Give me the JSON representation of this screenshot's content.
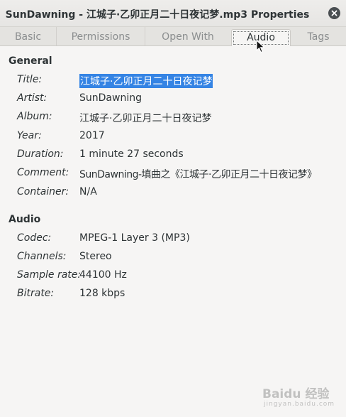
{
  "window": {
    "title": "SunDawning - 江城子·乙卯正月二十日夜记梦.mp3 Properties",
    "close_icon": "close-icon"
  },
  "tabs": [
    {
      "label": "Basic"
    },
    {
      "label": "Permissions"
    },
    {
      "label": "Open With"
    },
    {
      "label": "Audio",
      "active": true
    },
    {
      "label": "Tags"
    }
  ],
  "general": {
    "heading": "General",
    "rows": [
      {
        "label": "Title:",
        "value": "江城子·乙卯正月二十日夜记梦"
      },
      {
        "label": "Artist:",
        "value": "SunDawning"
      },
      {
        "label": "Album:",
        "value": "江城子·乙卯正月二十日夜记梦"
      },
      {
        "label": "Year:",
        "value": "2017"
      },
      {
        "label": "Duration:",
        "value": "1 minute 27 seconds"
      },
      {
        "label": "Comment:",
        "value": "SunDawning-填曲之《江城子·乙卯正月二十日夜记梦》"
      },
      {
        "label": "Container:",
        "value": "N/A"
      }
    ]
  },
  "audio": {
    "heading": "Audio",
    "rows": [
      {
        "label": "Codec:",
        "value": "MPEG-1 Layer 3 (MP3)"
      },
      {
        "label": "Channels:",
        "value": "Stereo"
      },
      {
        "label": "Sample rate:",
        "value": "44100 Hz"
      },
      {
        "label": "Bitrate:",
        "value": "128 kbps"
      }
    ]
  },
  "watermark": {
    "text": "Baidu 经验",
    "sub": "jingyan.baidu.com"
  },
  "colors": {
    "selection": "#3584e4",
    "background": "#f6f5f4"
  }
}
